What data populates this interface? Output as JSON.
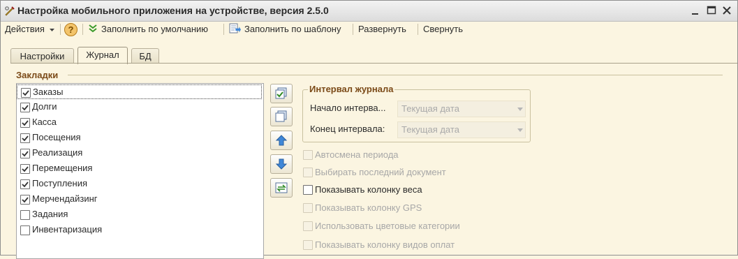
{
  "window": {
    "title": "Настройка мобильного приложения на устройстве, версия 2.5.0"
  },
  "toolbar": {
    "actions_label": "Действия",
    "fill_default_label": "Заполнить по умолчанию",
    "fill_template_label": "Заполнить по шаблону",
    "expand_label": "Развернуть",
    "collapse_label": "Свернуть"
  },
  "tabs": [
    {
      "label": "Настройки",
      "active": false
    },
    {
      "label": "Журнал",
      "active": true
    },
    {
      "label": "БД",
      "active": false
    }
  ],
  "bookmarks": {
    "title": "Закладки",
    "items": [
      {
        "label": "Заказы",
        "checked": true
      },
      {
        "label": "Долги",
        "checked": true
      },
      {
        "label": "Касса",
        "checked": true
      },
      {
        "label": "Посещения",
        "checked": true
      },
      {
        "label": "Реализация",
        "checked": true
      },
      {
        "label": "Перемещения",
        "checked": true
      },
      {
        "label": "Поступления",
        "checked": true
      },
      {
        "label": "Мерчендайзинг",
        "checked": true
      },
      {
        "label": "Задания",
        "checked": false
      },
      {
        "label": "Инвентаризация",
        "checked": false
      }
    ]
  },
  "interval": {
    "title": "Интервал журнала",
    "start_label": "Начало интерва...",
    "start_value": "Текущая дата",
    "end_label": "Конец интервала:",
    "end_value": "Текущая дата"
  },
  "options": [
    {
      "label": "Автосмена периода",
      "checked": false,
      "enabled": false
    },
    {
      "label": "Выбирать последний документ",
      "checked": false,
      "enabled": false
    },
    {
      "label": "Показывать колонку веса",
      "checked": false,
      "enabled": true
    },
    {
      "label": "Показывать колонку GPS",
      "checked": false,
      "enabled": false
    },
    {
      "label": "Использовать цветовые категории",
      "checked": false,
      "enabled": false
    },
    {
      "label": "Показывать колонку видов оплат",
      "checked": false,
      "enabled": false
    }
  ],
  "colors": {
    "group_title": "#7b4a18",
    "fill_default_icon": "#3a9a2a",
    "arrow_icon": "#3f87d8"
  }
}
